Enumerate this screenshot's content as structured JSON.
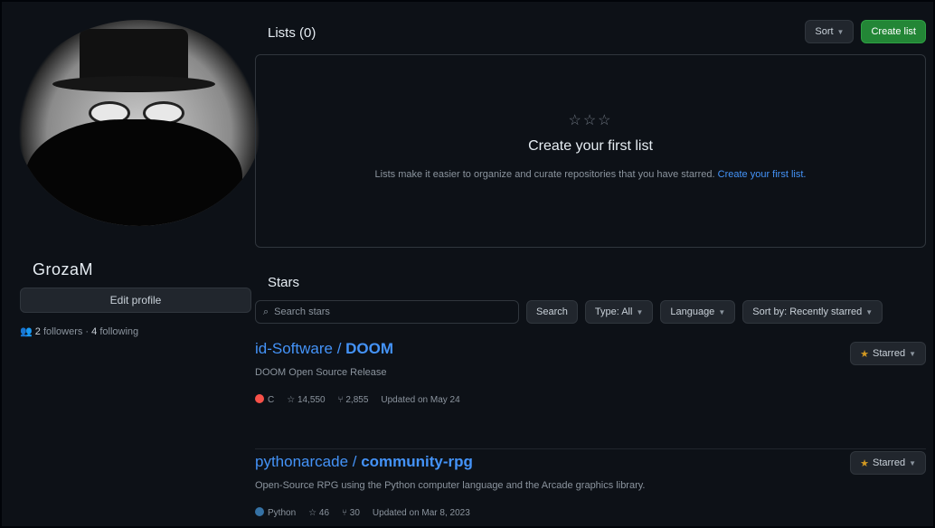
{
  "profile": {
    "username": "GrozaM",
    "edit_label": "Edit profile",
    "followers_count": "2",
    "followers_label": "followers",
    "separator": "·",
    "following_count": "4",
    "following_label": "following"
  },
  "lists": {
    "title": "Lists (0)",
    "sort_label": "Sort",
    "create_label": "Create list",
    "empty_title": "Create your first list",
    "empty_desc": "Lists make it easier to organize and curate repositories that you have starred.",
    "empty_link": "Create your first list."
  },
  "stars": {
    "title": "Stars",
    "search_placeholder": "Search stars",
    "search_button": "Search",
    "type_filter": "Type: All",
    "language_filter": "Language",
    "sort_filter": "Sort by: Recently starred"
  },
  "repos": [
    {
      "owner": "id-Software",
      "slash": " / ",
      "name": "DOOM",
      "description": "DOOM Open Source Release",
      "language": "C",
      "language_color": "#f85149",
      "stars": "14,550",
      "forks": "2,855",
      "updated": "Updated on May 24",
      "starred_label": "Starred"
    },
    {
      "owner": "pythonarcade",
      "slash": " / ",
      "name": "community-rpg",
      "description": "Open-Source RPG using the Python computer language and the Arcade graphics library.",
      "language": "Python",
      "language_color": "#3572A5",
      "stars": "46",
      "forks": "30",
      "updated": "Updated on Mar 8, 2023",
      "starred_label": "Starred"
    }
  ],
  "colors": {
    "background": "#0d1117",
    "accent": "#4493f8",
    "green": "#238636",
    "star": "#d29922"
  }
}
